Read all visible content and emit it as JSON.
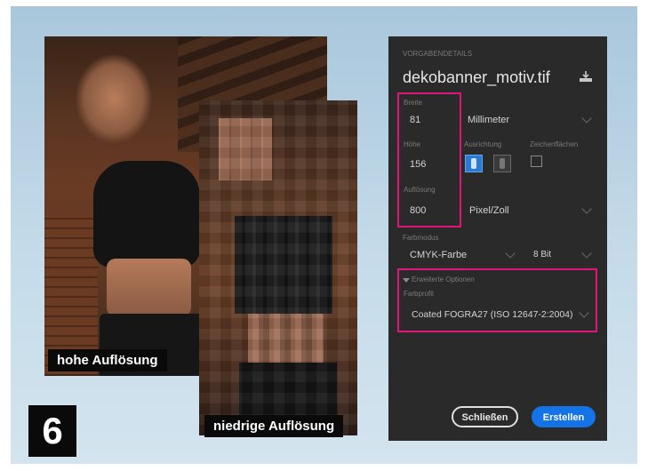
{
  "step_number": "6",
  "captions": {
    "high": "hohe Auflösung",
    "low": "niedrige Auflösung"
  },
  "dialog": {
    "section_label": "VORGABENDETAILS",
    "filename": "dekobanner_motiv.tif",
    "width": {
      "label": "Breite",
      "value": "81",
      "unit": "Millimeter"
    },
    "height": {
      "label": "Höhe",
      "value": "156"
    },
    "orientation": {
      "label": "Ausrichtung"
    },
    "artboards": {
      "label": "Zeichenflächen"
    },
    "resolution": {
      "label": "Auflösung",
      "value": "800",
      "unit": "Pixel/Zoll"
    },
    "color_mode": {
      "label": "Farbmodus",
      "value": "CMYK-Farbe",
      "depth": "8 Bit"
    },
    "advanced": {
      "label": "Erweiterte Optionen"
    },
    "color_profile": {
      "label": "Farbprofil",
      "value": "Coated FOGRA27 (ISO 12647-2:2004)"
    },
    "buttons": {
      "close": "Schließen",
      "create": "Erstellen"
    }
  },
  "colors": {
    "highlight": "#e0157a",
    "primary_button": "#1473e6",
    "panel_bg": "#2a2a2a"
  },
  "icons": [
    "save-preset-icon",
    "portrait-orientation-icon",
    "landscape-orientation-icon",
    "artboard-checkbox-icon",
    "chevron-down-icon",
    "disclosure-triangle-icon"
  ]
}
